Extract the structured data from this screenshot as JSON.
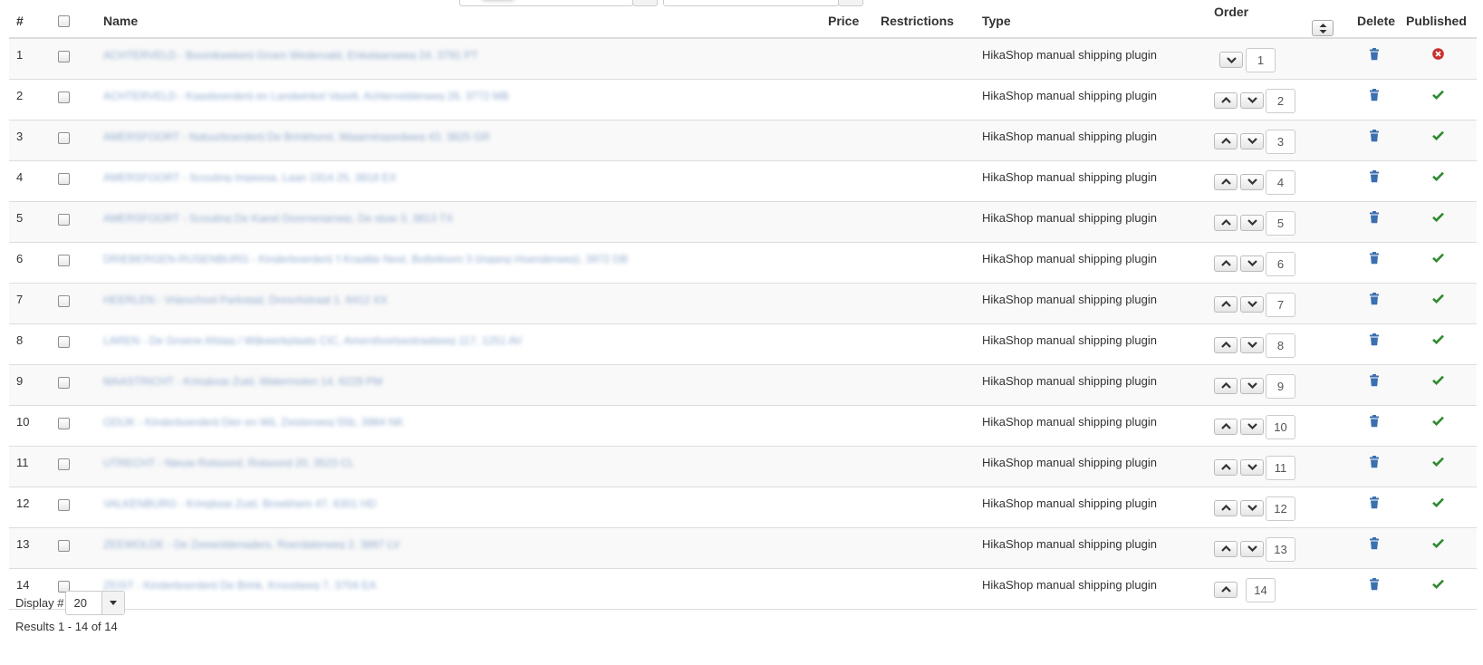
{
  "columns": {
    "index": "#",
    "name": "Name",
    "price": "Price",
    "restrictions": "Restrictions",
    "type": "Type",
    "order": "Order",
    "delete": "Delete",
    "published": "Published"
  },
  "colors": {
    "trash": "#3a6fb0",
    "check": "#2f8a2f",
    "unpublished": "#c9302c",
    "row_stripe": "#f9f9f9",
    "border": "#dddddd"
  },
  "rows": [
    {
      "num": "1",
      "name": "ACHTERVELD - Boomkwekerij Groen Wedervald, Enkelaarsweg 24, 3791 PT",
      "type": "HikaShop manual shipping plugin",
      "order": "1",
      "published": false
    },
    {
      "num": "2",
      "name": "ACHTERVELD - Kaasboerderij en Landwinkel Vaselt, Achtervelderweg 26, 3772 MB",
      "type": "HikaShop manual shipping plugin",
      "order": "2",
      "published": true
    },
    {
      "num": "3",
      "name": "AMERSFOORT - Natuurboerderij De Brinkhorst, Wageningsedweg 43, 3825 GR",
      "type": "HikaShop manual shipping plugin",
      "order": "3",
      "published": true
    },
    {
      "num": "4",
      "name": "AMERSFOORT - Scouting Impeesa, Laan 1914 25, 3818 EX",
      "type": "HikaShop manual shipping plugin",
      "order": "4",
      "published": true
    },
    {
      "num": "5",
      "name": "AMERSFOORT - Scouting De Kaeel Doornengroep, De stuw 3, 3813 TX",
      "type": "HikaShop manual shipping plugin",
      "order": "5",
      "published": true
    },
    {
      "num": "6",
      "name": "DRIEBERGEN-RIJSENBURG - Kinderboerderij 't Kraaltje Nest, Bottelloom 3 (ingang Hoenderweg), 3972 DB",
      "type": "HikaShop manual shipping plugin",
      "order": "6",
      "published": true
    },
    {
      "num": "7",
      "name": "HEERLEN - Vrijeschool Parkstad, Dreschstraat 1, 6412 XX",
      "type": "HikaShop manual shipping plugin",
      "order": "7",
      "published": true
    },
    {
      "num": "8",
      "name": "LAREN - De Groene Afslag / Wijkwerkplaats CIC, Amersfoortsestraatweg 117, 1251 AV",
      "type": "HikaShop manual shipping plugin",
      "order": "8",
      "published": true
    },
    {
      "num": "9",
      "name": "MAASTRICHT - Kringloop Zuid, Watermolen 14, 6229 PM",
      "type": "HikaShop manual shipping plugin",
      "order": "9",
      "published": true
    },
    {
      "num": "10",
      "name": "ODIJK - Kinderboerderij Dier en Wij, Zeisterweg 55b, 3984 NK",
      "type": "HikaShop manual shipping plugin",
      "order": "10",
      "published": true
    },
    {
      "num": "11",
      "name": "UTRECHT - Nieuw Rotsoord, Rotsoord 20, 3523 CL",
      "type": "HikaShop manual shipping plugin",
      "order": "11",
      "published": true
    },
    {
      "num": "12",
      "name": "VALKENBURG - Kringloop Zuid, Broekhem 47, 6301 HD",
      "type": "HikaShop manual shipping plugin",
      "order": "12",
      "published": true
    },
    {
      "num": "13",
      "name": "ZEEWOLDE - De Zeewoldenaders, Roerdalerweg 2, 3897 LV",
      "type": "HikaShop manual shipping plugin",
      "order": "13",
      "published": true
    },
    {
      "num": "14",
      "name": "ZEIST - Kinderboerderij De Brink, Kroostweg 7, 3704 EA",
      "type": "HikaShop manual shipping plugin",
      "order": "14",
      "published": true
    }
  ],
  "footer": {
    "display_label": "Display #",
    "display_value": "20",
    "results": "Results 1 - 14 of 14"
  }
}
